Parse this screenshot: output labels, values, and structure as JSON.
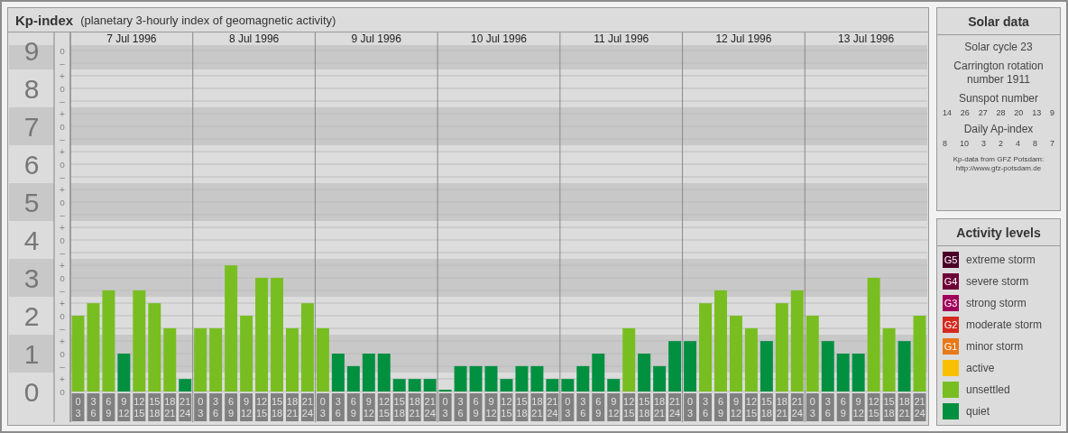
{
  "title": "Kp-index",
  "subtitle": "(planetary 3-hourly index of geomagnetic activity)",
  "dates": [
    "7 Jul 1996",
    "8 Jul 1996",
    "9 Jul 1996",
    "10 Jul 1996",
    "11 Jul 1996",
    "12 Jul 1996",
    "13 Jul 1996"
  ],
  "scale_marks": [
    "o",
    "–",
    "+",
    "o",
    "–",
    "+",
    "o",
    "–",
    "+",
    "o",
    "–",
    "+",
    "o",
    "–",
    "+",
    "o",
    "–",
    "+",
    "o",
    "–",
    "+",
    "o",
    "–",
    "+",
    "o",
    "–",
    "+",
    "o"
  ],
  "chart_data": {
    "type": "bar",
    "stacked": true,
    "grid": true,
    "categories": [
      "0\n3",
      "3\n6",
      "6\n9",
      "9\n12",
      "12\n15",
      "15\n18",
      "18\n21",
      "21\n24",
      "0\n3",
      "3\n6",
      "6\n9",
      "9\n12",
      "12\n15",
      "15\n18",
      "18\n21",
      "21\n24",
      "0\n3",
      "3\n6",
      "6\n9",
      "9\n12",
      "12\n15",
      "15\n18",
      "18\n21",
      "21\n24",
      "0\n3",
      "3\n6",
      "6\n9",
      "9\n12",
      "12\n15",
      "15\n18",
      "18\n21",
      "21\n24",
      "0\n3",
      "3\n6",
      "6\n9",
      "9\n12",
      "12\n15",
      "15\n18",
      "18\n21",
      "21\n24",
      "0\n3",
      "3\n6",
      "6\n9",
      "9\n12",
      "12\n15",
      "15\n18",
      "18\n21",
      "21\n24",
      "0\n3",
      "3\n6",
      "6\n9",
      "9\n12",
      "12\n15",
      "15\n18",
      "18\n21",
      "21\n24"
    ],
    "ylim": [
      0,
      9
    ],
    "yticks": [
      0,
      1,
      2,
      3,
      4,
      5,
      6,
      7,
      8,
      9
    ],
    "series": [
      {
        "color": "#009040",
        "values": [
          null,
          null,
          null,
          1,
          null,
          null,
          null,
          0.33,
          null,
          null,
          null,
          null,
          null,
          null,
          null,
          null,
          null,
          1,
          0.67,
          1,
          1,
          0.33,
          0.33,
          0.33,
          0,
          0.67,
          0.67,
          0.67,
          0.33,
          0.67,
          0.67,
          0.33,
          0.33,
          0.67,
          1,
          0.33,
          null,
          1,
          0.67,
          1.33,
          1.33,
          null,
          null,
          null,
          null,
          1.33,
          null,
          null,
          null,
          1.33,
          1,
          1,
          null,
          null,
          1.33,
          null
        ]
      },
      {
        "color": "#78be20",
        "values": [
          2,
          2.33,
          2.67,
          null,
          2.67,
          2.33,
          1.67,
          null,
          1.67,
          1.67,
          3.33,
          2,
          3,
          3,
          1.67,
          2.33,
          1.67,
          null,
          null,
          null,
          null,
          null,
          null,
          null,
          null,
          null,
          null,
          null,
          null,
          null,
          null,
          null,
          null,
          null,
          null,
          null,
          1.67,
          null,
          null,
          null,
          null,
          2.33,
          2.67,
          2,
          1.67,
          null,
          2.33,
          2.67,
          2,
          null,
          null,
          null,
          3,
          1.67,
          null,
          2
        ]
      }
    ]
  },
  "solar_data": {
    "title": "Solar data",
    "cycle": "Solar cycle 23",
    "carrington": "Carrington rotation number 1911",
    "sunspot_label": "Sunspot number",
    "sunspot_numbers": [
      "14",
      "26",
      "27",
      "28",
      "20",
      "13",
      "9"
    ],
    "ap_label": "Daily Ap-index",
    "ap_values": [
      "8",
      "10",
      "3",
      "2",
      "4",
      "8",
      "7"
    ],
    "source": "Kp-data from GFZ Potsdam:",
    "source_url": "http://www.gfz-potsdam.de"
  },
  "activity_levels": {
    "title": "Activity levels",
    "items": [
      {
        "code": "G5",
        "label": "extreme storm",
        "color": "#4b0028"
      },
      {
        "code": "G4",
        "label": "severe storm",
        "color": "#6e0038"
      },
      {
        "code": "G3",
        "label": "strong storm",
        "color": "#a0005a"
      },
      {
        "code": "G2",
        "label": "moderate storm",
        "color": "#d42a1e"
      },
      {
        "code": "G1",
        "label": "minor storm",
        "color": "#e87818"
      },
      {
        "label": "active",
        "color": "#f8c000"
      },
      {
        "label": "unsettled",
        "color": "#78be20"
      },
      {
        "label": "quiet",
        "color": "#009040"
      }
    ]
  }
}
